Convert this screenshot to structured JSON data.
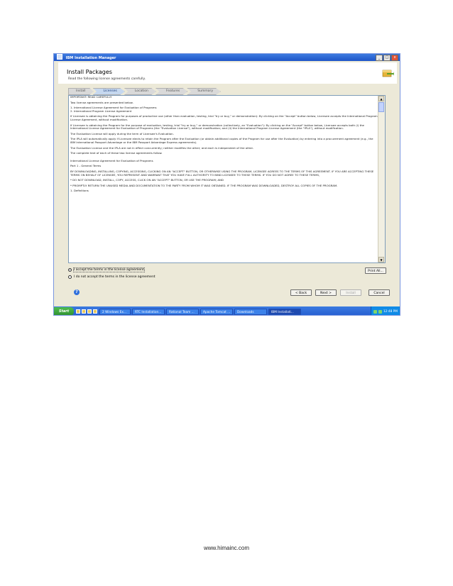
{
  "window": {
    "title": "IBM Installation Manager",
    "controls": [
      "_",
      "□",
      "x"
    ]
  },
  "header": {
    "title": "Install Packages",
    "subtitle": "Read the following license agreements carefully."
  },
  "wizard_steps": [
    "Install",
    "Licenses",
    "Location",
    "Features",
    "Summary"
  ],
  "license_text": [
    "IMPORTANT: READ CAREFULLY",
    "Two license agreements are presented below.",
    "1. International License Agreement for Evaluation of Programs\n2. International Program License Agreement",
    "If Licensee is obtaining the Program for purposes of productive use (other than evaluation, testing, trial \"try or buy,\" or demonstration): By clicking on the \"Accept\" button below, Licensee accepts the International Program License Agreement, without modification.",
    "If Licensee is obtaining the Program for the purpose of evaluation, testing, trial \"try or buy,\" or demonstration (collectively, an \"Evaluation\"): By clicking on the \"Accept\" button below, Licensee accepts both (i) the International License Agreement for Evaluation of Programs (the \"Evaluation License\"), without modification; and (ii) the International Program License Agreement (the \"IPLA\"), without modification.",
    "The Evaluation License will apply during the term of Licensee's Evaluation.",
    "The IPLA will automatically apply if Licensee elects to retain the Program after the Evaluation (or obtain additional copies of the Program for use after the Evaluation) by entering into a procurement agreement (e.g., the IBM International Passport Advantage or the IBM Passport Advantage Express agreements).",
    "The Evaluation License and the IPLA are not in effect concurrently; neither modifies the other; and each is independent of the other.",
    "The complete text of each of these two license agreements follow.",
    "International License Agreement for Evaluation of Programs",
    "Part 1 - General Terms",
    "BY DOWNLOADING, INSTALLING, COPYING, ACCESSING, CLICKING ON AN \"ACCEPT\" BUTTON, OR OTHERWISE USING THE PROGRAM, LICENSEE AGREES TO THE TERMS OF THIS AGREEMENT. IF YOU ARE ACCEPTING THESE TERMS ON BEHALF OF LICENSEE, YOU REPRESENT AND WARRANT THAT YOU HAVE FULL AUTHORITY TO BIND LICENSEE TO THESE TERMS. IF YOU DO NOT AGREE TO THESE TERMS,",
    "* DO NOT DOWNLOAD, INSTALL, COPY, ACCESS, CLICK ON AN \"ACCEPT\" BUTTON, OR USE THE PROGRAM; AND",
    "* PROMPTLY RETURN THE UNUSED MEDIA AND DOCUMENTATION TO THE PARTY FROM WHOM IT WAS OBTAINED. IF THE PROGRAM WAS DOWNLOADED, DESTROY ALL COPIES OF THE PROGRAM.",
    "1. Definitions"
  ],
  "radios": {
    "accept": "I accept the terms in the license agreement",
    "decline": "I do not accept the terms in the license agreement"
  },
  "buttons": {
    "print": "Print All...",
    "back": "< Back",
    "next": "Next >",
    "install": "Install",
    "cancel": "Cancel",
    "help": "?"
  },
  "taskbar": {
    "start": "Start",
    "tasks": [
      "2 Windows Ex...",
      "RTC Installation...",
      "Rational Team ...",
      "Apache Tomcat ...",
      "Downloads",
      "IBM Installati..."
    ],
    "clock": "12:48 PM"
  },
  "footer": "www.himainc.com"
}
